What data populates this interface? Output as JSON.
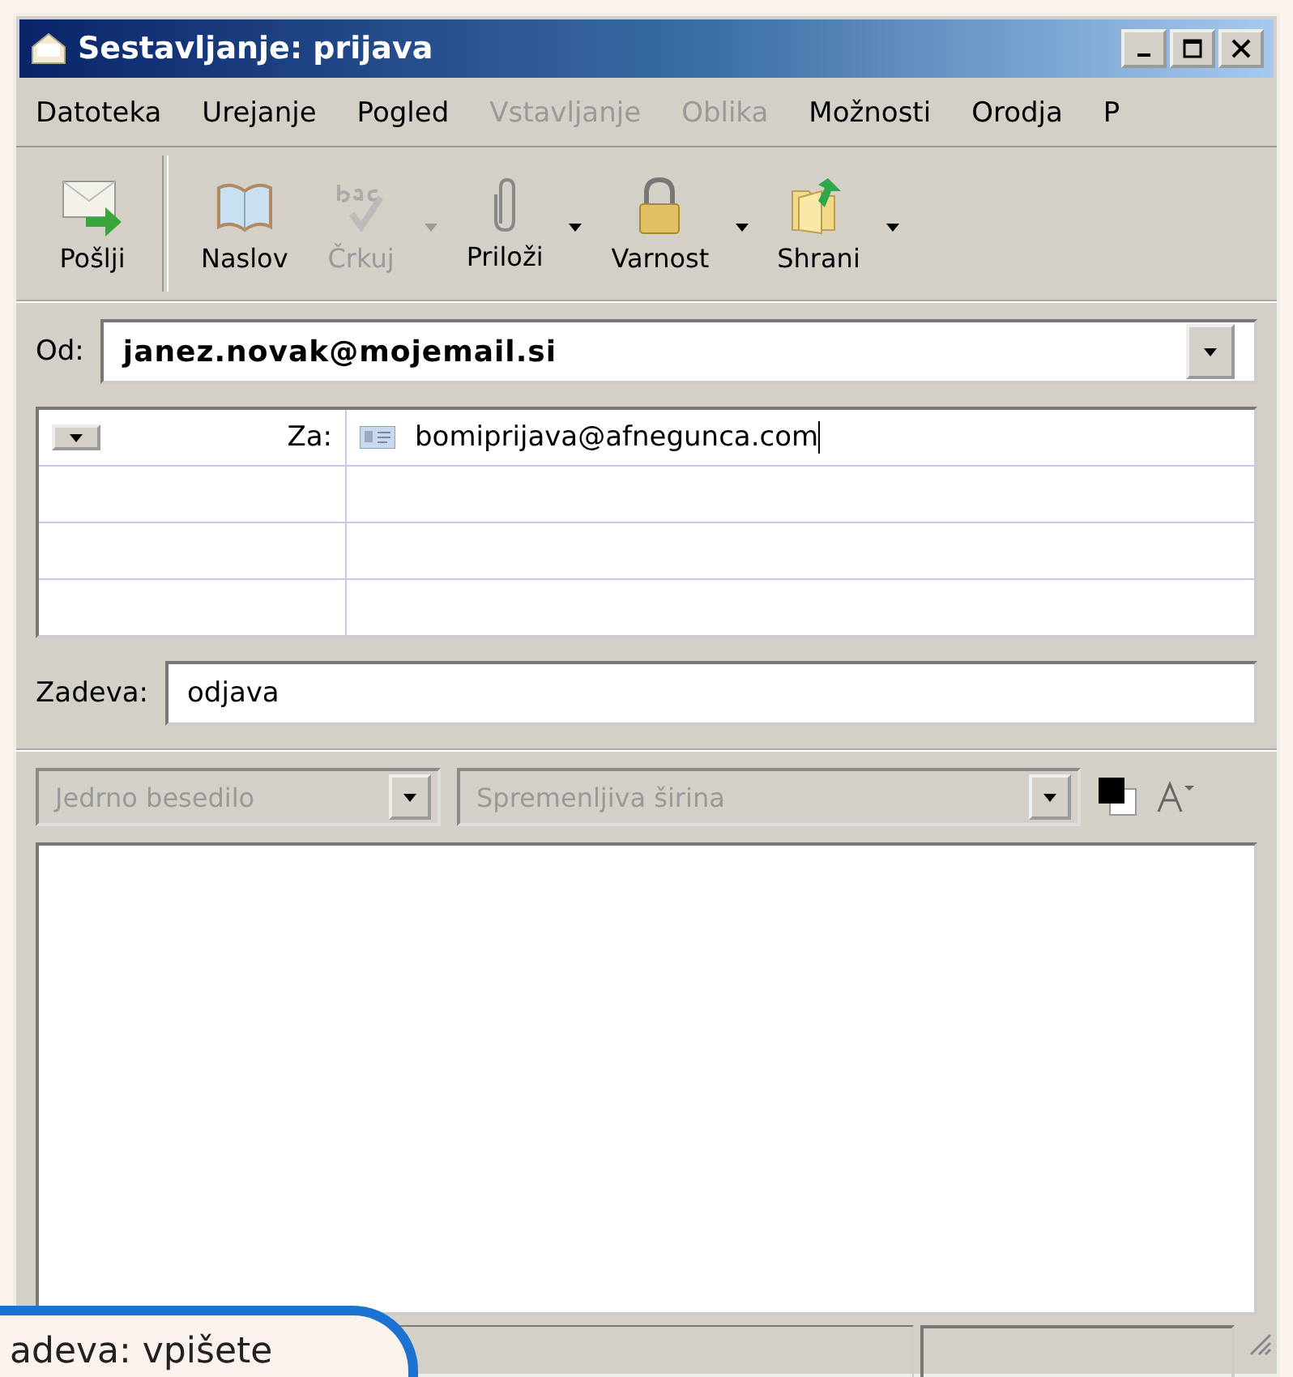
{
  "window": {
    "title": "Sestavljanje: prijava"
  },
  "menu": [
    {
      "label": "Datoteka",
      "disabled": false
    },
    {
      "label": "Urejanje",
      "disabled": false
    },
    {
      "label": "Pogled",
      "disabled": false
    },
    {
      "label": "Vstavljanje",
      "disabled": true
    },
    {
      "label": "Oblika",
      "disabled": true
    },
    {
      "label": "Možnosti",
      "disabled": false
    },
    {
      "label": "Orodja",
      "disabled": false
    },
    {
      "label": "P",
      "disabled": false
    }
  ],
  "toolbar": [
    {
      "kind": "send",
      "label": "Pošlji",
      "disabled": false,
      "dropdown": false
    },
    {
      "kind": "book",
      "label": "Naslov",
      "disabled": false,
      "dropdown": false
    },
    {
      "kind": "spell",
      "label": "Črkuj",
      "disabled": true,
      "dropdown": true
    },
    {
      "kind": "clip",
      "label": "Priloži",
      "disabled": false,
      "dropdown": true
    },
    {
      "kind": "lock",
      "label": "Varnost",
      "disabled": false,
      "dropdown": true
    },
    {
      "kind": "save",
      "label": "Shrani",
      "disabled": false,
      "dropdown": true
    }
  ],
  "from": {
    "label": "Od:",
    "value": "janez.novak@mojemail.si"
  },
  "recipients": [
    {
      "type": "Za:",
      "address": "bomiprijava@afnegunca.com"
    }
  ],
  "subject": {
    "label": "Zadeva:",
    "value": "odjava"
  },
  "format": {
    "paragraph": "Jedrno besedilo",
    "font": "Spremenljiva širina"
  },
  "callout": {
    "text": "adeva: vpišete"
  }
}
